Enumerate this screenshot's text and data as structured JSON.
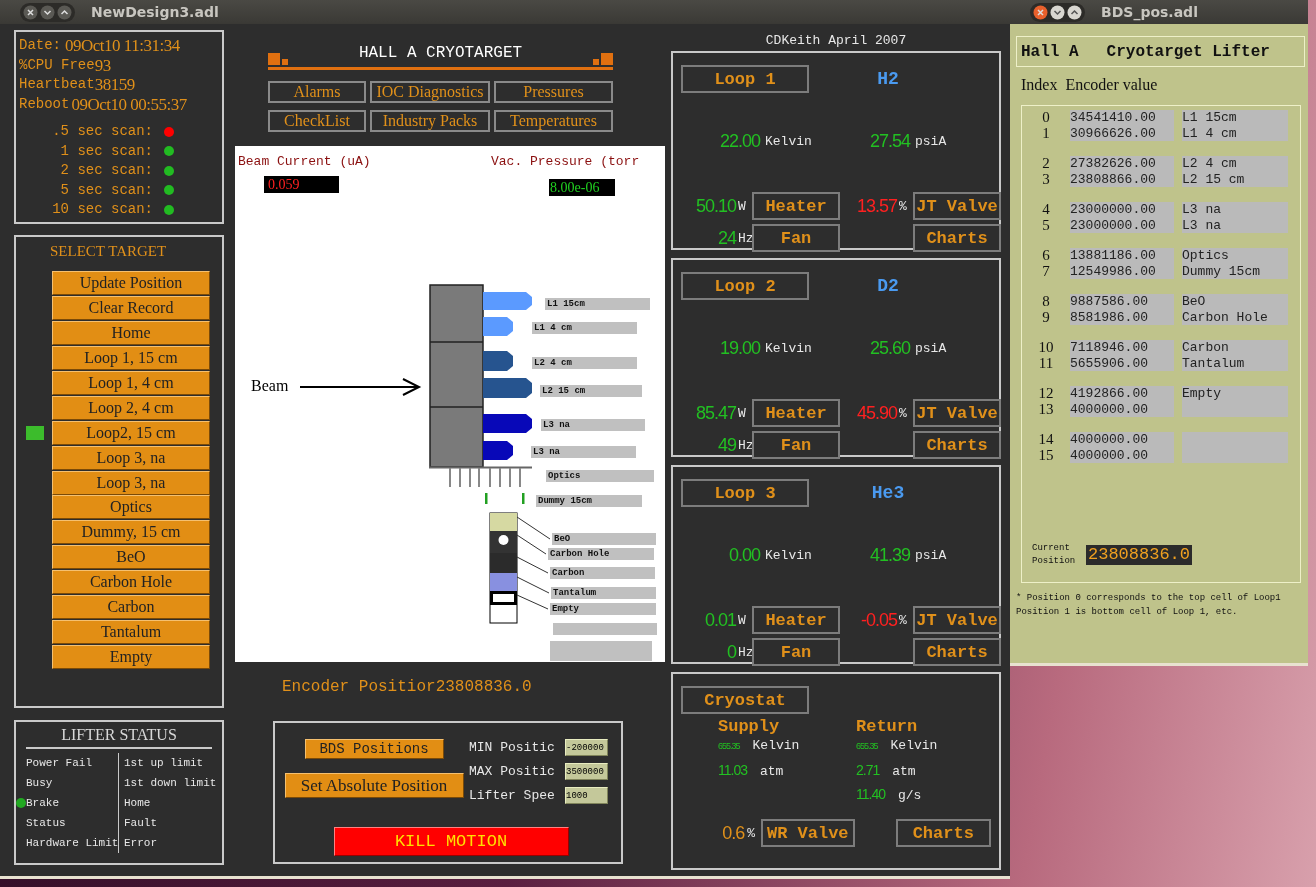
{
  "main_window": {
    "title": "NewDesign3.adl",
    "status": {
      "date_label": "Date:",
      "date": "09Oct10 11:31:34",
      "cpu_label": "%CPU Free",
      "cpu": "93",
      "heartbeat_label": "Heartbeat",
      "heartbeat": "38159",
      "reboot_label": "Reboot",
      "reboot": "09Oct10 00:55:37",
      "scans": [
        {
          "label": ".5 sec scan:",
          "color": "#ff0000"
        },
        {
          "label": "1 sec scan:",
          "color": "#22bb22"
        },
        {
          "label": "2 sec scan:",
          "color": "#22bb22"
        },
        {
          "label": "5 sec scan:",
          "color": "#22bb22"
        },
        {
          "label": "10 sec scan:",
          "color": "#22bb22"
        }
      ]
    },
    "select_target": {
      "title": "SELECT TARGET",
      "buttons": [
        {
          "label": "Update Position",
          "selected": false
        },
        {
          "label": "Clear Record",
          "selected": false
        },
        {
          "label": "Home",
          "selected": false
        },
        {
          "label": "Loop 1, 15 cm",
          "selected": false
        },
        {
          "label": "Loop 1, 4 cm",
          "selected": false
        },
        {
          "label": "Loop 2, 4 cm",
          "selected": false
        },
        {
          "label": "Loop2, 15 cm",
          "selected": true
        },
        {
          "label": "Loop 3, na",
          "selected": false
        },
        {
          "label": "Loop 3, na",
          "selected": false
        },
        {
          "label": "Optics",
          "selected": false
        },
        {
          "label": "Dummy, 15 cm",
          "selected": false
        },
        {
          "label": "BeO",
          "selected": false
        },
        {
          "label": "Carbon Hole",
          "selected": false
        },
        {
          "label": "Carbon",
          "selected": false
        },
        {
          "label": "Tantalum",
          "selected": false
        },
        {
          "label": "Empty",
          "selected": false
        }
      ]
    },
    "lifter_status": {
      "title": "LIFTER STATUS",
      "left": [
        {
          "label": "Power Fail",
          "on": false
        },
        {
          "label": "Busy",
          "on": false
        },
        {
          "label": "Brake",
          "on": true
        },
        {
          "label": "Status",
          "on": false
        },
        {
          "label": "Hardware Limit",
          "on": false
        }
      ],
      "right": [
        "1st up limit",
        "1st down limit",
        "Home",
        "Fault",
        "Error"
      ]
    },
    "header": {
      "title": "HALL A CRYOTARGET",
      "buttons": [
        "Alarms",
        "IOC Diagnostics",
        "Pressures",
        "CheckList",
        "Industry Packs",
        "Temperatures"
      ]
    },
    "diagram": {
      "beam_current_label": "Beam Current (uA)",
      "beam_current": "0.059",
      "vac_pressure_label": "Vac. Pressure (torr",
      "vac_pressure": "8.00e-06",
      "beam_label": "Beam",
      "targets": [
        {
          "label": "L1 15cm",
          "kind": "cryo_long",
          "color": "#5b9aff"
        },
        {
          "label": "L1 4 cm",
          "kind": "cryo_short",
          "color": "#5b9aff"
        },
        {
          "label": "L2 4 cm",
          "kind": "cryo_short",
          "color": "#26548f"
        },
        {
          "label": "L2 15 cm",
          "kind": "cryo_long",
          "color": "#26548f"
        },
        {
          "label": "L3 na",
          "kind": "cryo_long",
          "color": "#0808b8"
        },
        {
          "label": "L3 na",
          "kind": "cryo_short",
          "color": "#0808b8"
        },
        {
          "label": "Optics",
          "kind": "foil"
        },
        {
          "label": "Dummy 15cm",
          "kind": "foil"
        },
        {
          "label": "BeO",
          "kind": "solid",
          "color": "#d6d9a2"
        },
        {
          "label": "Carbon Hole",
          "kind": "solid_hole",
          "color": "#333333"
        },
        {
          "label": "Carbon",
          "kind": "solid",
          "color": "#2b2b2b"
        },
        {
          "label": "Tantalum",
          "kind": "solid",
          "color": "#8890e0"
        },
        {
          "label": "Empty",
          "kind": "empty"
        }
      ]
    },
    "encoder": {
      "label": "Encoder Positior",
      "value": "23808836.0"
    },
    "motion": {
      "bds_button": "BDS Positions",
      "set_button": "Set Absolute Position",
      "fields": [
        {
          "label": "MIN Positic",
          "value": "-200000"
        },
        {
          "label": "MAX Positic",
          "value": "3500000"
        },
        {
          "label": "Lifter Spee",
          "value": "1000"
        }
      ],
      "kill_button": "KILL MOTION"
    },
    "credit": "CDKeith April 2007",
    "loops": [
      {
        "button": "Loop 1",
        "gas": "H2",
        "temperature": "22.00",
        "temperature_unit": "Kelvin",
        "pressure": "27.54",
        "pressure_unit": "psiA",
        "heater_power": "50.10",
        "heater_unit": "W",
        "heater_button": "Heater",
        "jt_valve": "13.57",
        "jt_unit": "%",
        "jt_button": "JT Valve",
        "fan": "24",
        "fan_unit": "Hz",
        "fan_button": "Fan",
        "charts_button": "Charts"
      },
      {
        "button": "Loop 2",
        "gas": "D2",
        "temperature": "19.00",
        "temperature_unit": "Kelvin",
        "pressure": "25.60",
        "pressure_unit": "psiA",
        "heater_power": "85.47",
        "heater_unit": "W",
        "heater_button": "Heater",
        "jt_valve": "45.90",
        "jt_unit": "%",
        "jt_button": "JT Valve",
        "fan": "49",
        "fan_unit": "Hz",
        "fan_button": "Fan",
        "charts_button": "Charts"
      },
      {
        "button": "Loop 3",
        "gas": "He3",
        "temperature": "0.00",
        "temperature_unit": "Kelvin",
        "pressure": "41.39",
        "pressure_unit": "psiA",
        "heater_power": "0.01",
        "heater_unit": "W",
        "heater_button": "Heater",
        "jt_valve": "-0.05",
        "jt_unit": "%",
        "jt_button": "JT Valve",
        "fan": "0",
        "fan_unit": "Hz",
        "fan_button": "Fan",
        "charts_button": "Charts"
      }
    ],
    "cryostat": {
      "button": "Cryostat",
      "supply": {
        "title": "Supply",
        "temperature": "655.35",
        "temperature_unit": "Kelvin",
        "pressure": "11.03",
        "pressure_unit": "atm"
      },
      "return": {
        "title": "Return",
        "temperature": "655.35",
        "temperature_unit": "Kelvin",
        "pressure": "2.71",
        "pressure_unit": "atm",
        "flow": "11.40",
        "flow_unit": "g/s"
      },
      "wr_valve": "0.6",
      "wr_unit": "%",
      "wr_button": "WR Valve",
      "charts_button": "Charts"
    }
  },
  "bds_window": {
    "title": "BDS_pos.adl",
    "heading_left": "Hall A",
    "heading_right": "Cryotarget Lifter",
    "columns": [
      "Index",
      "Encoder value"
    ],
    "groups": [
      [
        {
          "index": "0",
          "value": "34541410.00",
          "target": "L1 15cm"
        },
        {
          "index": "1",
          "value": "30966626.00",
          "target": "L1 4 cm"
        }
      ],
      [
        {
          "index": "2",
          "value": "27382626.00",
          "target": "L2 4 cm"
        },
        {
          "index": "3",
          "value": "23808866.00",
          "target": "L2 15 cm"
        }
      ],
      [
        {
          "index": "4",
          "value": "23000000.00",
          "target": "L3 na"
        },
        {
          "index": "5",
          "value": "23000000.00",
          "target": "L3 na"
        }
      ],
      [
        {
          "index": "6",
          "value": "13881186.00",
          "target": "Optics"
        },
        {
          "index": "7",
          "value": "12549986.00",
          "target": "Dummy 15cm"
        }
      ],
      [
        {
          "index": "8",
          "value": "9887586.00",
          "target": "BeO"
        },
        {
          "index": "9",
          "value": "8581986.00",
          "target": "Carbon Hole"
        }
      ],
      [
        {
          "index": "10",
          "value": "7118946.00",
          "target": "Carbon"
        },
        {
          "index": "11",
          "value": "5655906.00",
          "target": "Tantalum"
        }
      ],
      [
        {
          "index": "12",
          "value": "4192866.00",
          "target": "Empty"
        },
        {
          "index": "13",
          "value": "4000000.00"
        }
      ],
      [
        {
          "index": "14",
          "value": "4000000.00"
        },
        {
          "index": "15",
          "value": "4000000.00"
        }
      ]
    ],
    "current_label": "Current Position",
    "current_value": "23808836.0",
    "notes": [
      "* Position 0 corresponds to the top cell of Loop1",
      "Position 1 is bottom cell of Loop 1, etc."
    ]
  }
}
